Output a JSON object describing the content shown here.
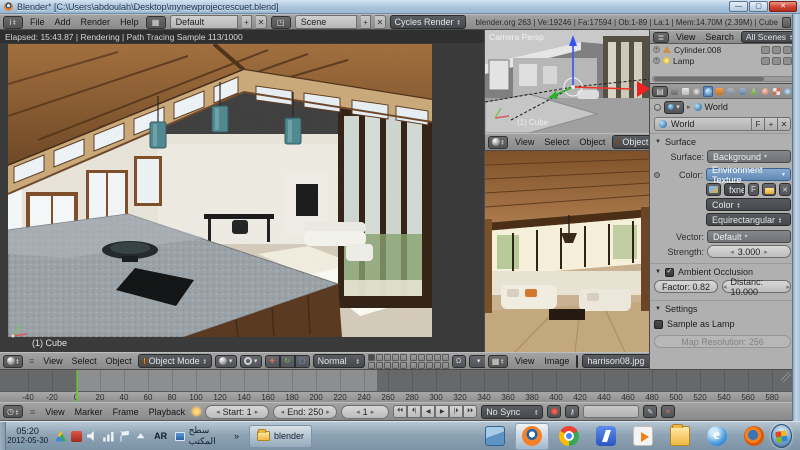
{
  "titlebar": {
    "title": "Blender* [C:\\Users\\abdoulah\\Desktop\\mynewprojecrescuet.blend]"
  },
  "info_bar": {
    "menus": [
      "File",
      "Add",
      "Render",
      "Help"
    ],
    "layout_name": "Default",
    "scene_name": "Scene",
    "engine": "Cycles Render",
    "stats": "blender.org 263 | Ve:19246 | Fa:17594 | Ob:1-89 | La:1 | Mem:14.70M (2.39M) | Cube"
  },
  "render_view": {
    "status": "Elapsed: 15:43.87 | Rendering | Path Tracing Sample 113/1000",
    "object_label": "(1) Cube"
  },
  "camera_view": {
    "label": "Camera Persp",
    "object_label": "(1) Cube",
    "menus": [
      "View",
      "Select",
      "Object"
    ],
    "mode": "Object Mode"
  },
  "image_editor": {
    "menus": [
      "View",
      "Image"
    ],
    "image_name": "harrison08.jpg"
  },
  "view3d_header": {
    "menus": [
      "View",
      "Select",
      "Object"
    ],
    "mode": "Object Mode",
    "orientation": "Normal"
  },
  "outliner": {
    "menus": [
      "View",
      "Search"
    ],
    "scene_filter": "All Scenes",
    "items": [
      {
        "name": "Cylinder.008"
      },
      {
        "name": "Lamp"
      }
    ]
  },
  "properties": {
    "breadcrumb": "World",
    "id_name": "World",
    "fake_user": "F",
    "surface": {
      "title": "Surface",
      "surface_label": "Surface:",
      "surface_value": "Background",
      "color_label": "Color:",
      "color_value": "Environment Texture",
      "image_name": "fxnet.hdr",
      "fake_user": "F",
      "color_space": "Color",
      "projection": "Equirectangular",
      "vector_label": "Vector:",
      "vector_value": "Default",
      "strength_label": "Strength:",
      "strength_value": "3.000"
    },
    "ambient_occlusion": {
      "title": "Ambient Occlusion",
      "factor": "Factor: 0.82",
      "distance": "Distanc: 10.000"
    },
    "settings": {
      "title": "Settings",
      "sample_as_lamp": "Sample as Lamp",
      "map_resolution": "Map Resolution: 256"
    }
  },
  "timeline": {
    "menus": [
      "View",
      "Marker",
      "Frame",
      "Playback"
    ],
    "start_label": "Start: 1",
    "end_label": "End: 250",
    "current_frame": "1",
    "sync": "No Sync",
    "tick_start": -40,
    "tick_end": 580,
    "tick_step": 20
  },
  "taskbar": {
    "time": "05:20",
    "date": "2012-05-30",
    "language": "AR",
    "toolbar_label": "سطح المكتب",
    "overflow_chevron": "»",
    "window_button": "blender",
    "apps": [
      "photo-viewer",
      "blender",
      "chrome",
      "chat",
      "media-player",
      "explorer",
      "ie",
      "firefox"
    ],
    "tray": [
      "drive",
      "security",
      "volume",
      "network",
      "flag",
      "hidden"
    ]
  }
}
